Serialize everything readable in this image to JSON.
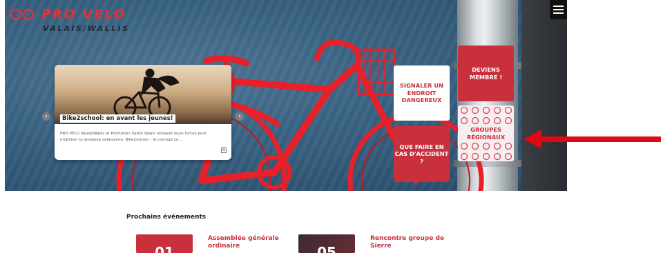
{
  "brand": {
    "name_main": "PRO VELO",
    "name_sub": "VALAIS/WALLIS",
    "accent_color": "#c8313c"
  },
  "header": {
    "menu_icon": "hamburger-icon"
  },
  "slider": {
    "prev_icon": "chevron-left-icon",
    "next_icon": "chevron-right-icon",
    "prev_label": "‹",
    "next_label": "›",
    "news": {
      "title": "Bike2school: en avant les jeunes!",
      "excerpt": "PRO VELO Valais/Wallis et Promotion Santé Valais unissent leurs forces pour mobiliser la jeunesse valaisanne. Bike2school – le concept Le ...",
      "more_icon": "expand-icon",
      "more_label": "⊞"
    }
  },
  "tiles": {
    "member": "DEVIENS MEMBRE !",
    "report": "SIGNALER UN ENDROIT DANGEREUX",
    "groups": "GROUPES RÉGIONAUX",
    "accident": "QUE FAIRE EN CAS D'ACCIDENT ?"
  },
  "annotation": {
    "arrow_color": "#e30613"
  },
  "events": {
    "heading": "Prochains événements",
    "items": [
      {
        "title": "Assemblée générale ordinaire",
        "day": "01",
        "color": "#c8313c"
      },
      {
        "title": "Rencontre groupe de Sierre",
        "day": "05",
        "color": "#6b2b35"
      }
    ]
  }
}
